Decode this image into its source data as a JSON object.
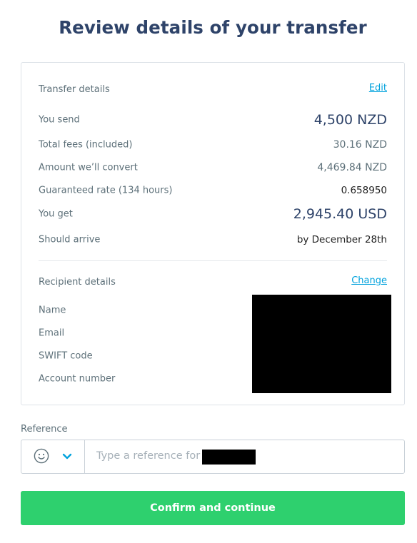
{
  "page": {
    "title": "Review details of your transfer"
  },
  "transfer": {
    "section_title": "Transfer details",
    "edit_label": "Edit",
    "rows": [
      {
        "label": "You send",
        "value": "4,500 NZD"
      },
      {
        "label": "Total fees (included)",
        "value": "30.16 NZD"
      },
      {
        "label": "Amount we’ll convert",
        "value": "4,469.84 NZD"
      },
      {
        "label": "Guaranteed rate (134 hours)",
        "value": "0.658950"
      },
      {
        "label": "You get",
        "value": "2,945.40 USD"
      },
      {
        "label": "Should arrive",
        "value": "by December 28th"
      }
    ]
  },
  "recipient": {
    "section_title": "Recipient details",
    "change_label": "Change",
    "rows": [
      {
        "label": "Name"
      },
      {
        "label": "Email"
      },
      {
        "label": "SWIFT code"
      },
      {
        "label": "Account number"
      }
    ]
  },
  "reference": {
    "label": "Reference",
    "placeholder": "Type a reference for",
    "emoji_icon": "smiley-icon",
    "dropdown_icon": "chevron-down-icon"
  },
  "confirm": {
    "label": "Confirm and continue"
  },
  "colors": {
    "accent_green": "#2ed06e",
    "link_blue": "#00a2dd",
    "title_navy": "#2e4369"
  }
}
